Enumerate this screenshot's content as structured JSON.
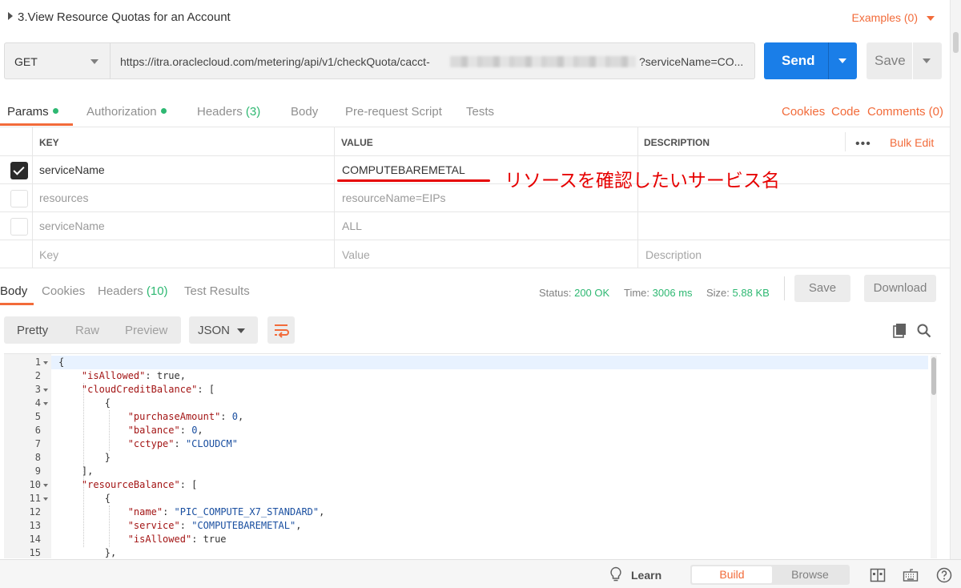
{
  "request": {
    "title": "3.View Resource Quotas for an Account",
    "examples_label": "Examples (0)",
    "method": "GET",
    "url_prefix": "https://itra.oraclecloud.com/metering/api/v1/checkQuota/cacct-",
    "url_suffix": "?serviceName=CO...",
    "send_label": "Send",
    "save_label": "Save"
  },
  "request_tabs": {
    "params": "Params",
    "authorization": "Authorization",
    "headers": "Headers",
    "headers_count": "(3)",
    "body": "Body",
    "prerequest": "Pre-request Script",
    "tests": "Tests",
    "cookies": "Cookies",
    "code": "Code",
    "comments": "Comments (0)"
  },
  "params_table": {
    "col_key": "KEY",
    "col_value": "VALUE",
    "col_description": "DESCRIPTION",
    "more": "•••",
    "bulk_edit": "Bulk Edit",
    "rows": [
      {
        "key": "serviceName",
        "value": "COMPUTEBAREMETAL",
        "checked": true
      },
      {
        "key": "resources",
        "value": "resourceName=EIPs",
        "checked": false
      },
      {
        "key": "serviceName",
        "value": "ALL",
        "checked": false
      }
    ],
    "placeholder_key": "Key",
    "placeholder_value": "Value",
    "placeholder_description": "Description"
  },
  "annotation": "リソースを確認したいサービス名",
  "response_tabs": {
    "body": "Body",
    "cookies": "Cookies",
    "headers": "Headers",
    "headers_count": "(10)",
    "test_results": "Test Results",
    "status_label": "Status:",
    "status_value": "200 OK",
    "time_label": "Time:",
    "time_value": "3006 ms",
    "size_label": "Size:",
    "size_value": "5.88 KB",
    "save_label": "Save",
    "download_label": "Download"
  },
  "response_toolbar": {
    "pretty": "Pretty",
    "raw": "Raw",
    "preview": "Preview",
    "format": "JSON"
  },
  "footer": {
    "learn": "Learn",
    "build": "Build",
    "browse": "Browse"
  },
  "colors": {
    "accent": "#f26b3a",
    "send_blue": "#1a7ee8",
    "status_green": "#2eb872",
    "annotation_red": "#e60000"
  },
  "icons": [
    "caret-right-icon",
    "chevron-down-icon",
    "check-icon",
    "more-icon",
    "wrap-icon",
    "copy-icon",
    "search-icon",
    "lightbulb-icon",
    "two-pane-icon",
    "keyboard-icon",
    "help-icon"
  ]
}
